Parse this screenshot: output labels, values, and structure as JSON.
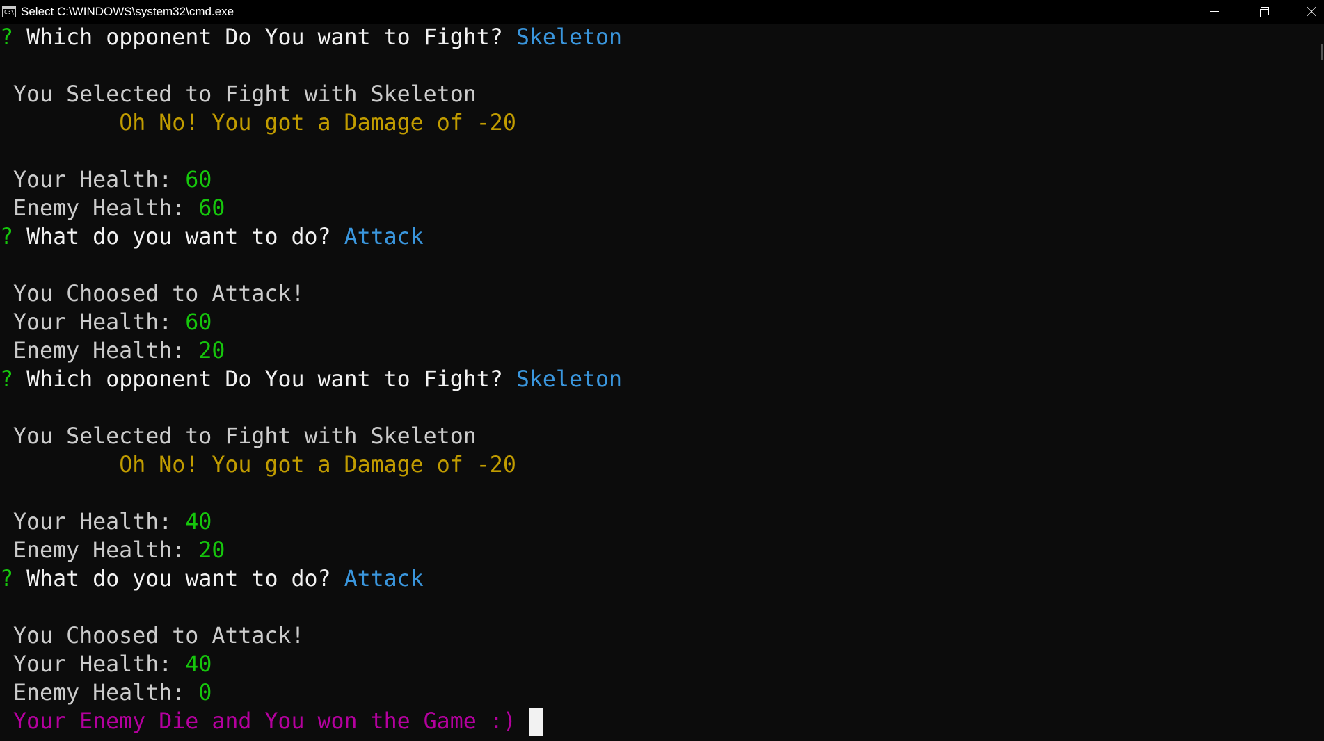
{
  "window": {
    "title": "Select C:\\WINDOWS\\system32\\cmd.exe",
    "icon_text": "C:\\_"
  },
  "console": {
    "lines": [
      {
        "prompt": "?",
        "text": "Which opponent Do You want to Fight?",
        "answer": "Skeleton"
      },
      {
        "blank": true
      },
      {
        "text": "You Selected to Fight with Skeleton"
      },
      {
        "warn": "Oh No! You got a Damage of -20"
      },
      {
        "blank": true
      },
      {
        "label": "Your Health:",
        "value": "60"
      },
      {
        "label": "Enemy Health:",
        "value": "60"
      },
      {
        "prompt": "?",
        "text": "What do you want to do?",
        "answer": "Attack"
      },
      {
        "blank": true
      },
      {
        "text": "You Choosed to Attack!"
      },
      {
        "label": "Your Health:",
        "value": "60"
      },
      {
        "label": "Enemy Health:",
        "value": "20"
      },
      {
        "prompt": "?",
        "text": "Which opponent Do You want to Fight?",
        "answer": "Skeleton"
      },
      {
        "blank": true
      },
      {
        "text": "You Selected to Fight with Skeleton"
      },
      {
        "warn": "Oh No! You got a Damage of -20"
      },
      {
        "blank": true
      },
      {
        "label": "Your Health:",
        "value": "40"
      },
      {
        "label": "Enemy Health:",
        "value": "20"
      },
      {
        "prompt": "?",
        "text": "What do you want to do?",
        "answer": "Attack"
      },
      {
        "blank": true
      },
      {
        "text": "You Choosed to Attack!"
      },
      {
        "label": "Your Health:",
        "value": "40"
      },
      {
        "label": "Enemy Health:",
        "value": "0"
      },
      {
        "victory": "Your Enemy Die and You won the Game :)"
      }
    ]
  },
  "colors": {
    "background": "#0c0c0c",
    "prompt": "#16c60c",
    "answer": "#3a96dd",
    "value": "#16c60c",
    "warning": "#c19c00",
    "victory": "#b4009e",
    "text": "#cccccc"
  },
  "icons": {
    "app": "cmd-icon",
    "minimize": "minimize-icon",
    "restore": "restore-icon",
    "close": "close-icon"
  }
}
